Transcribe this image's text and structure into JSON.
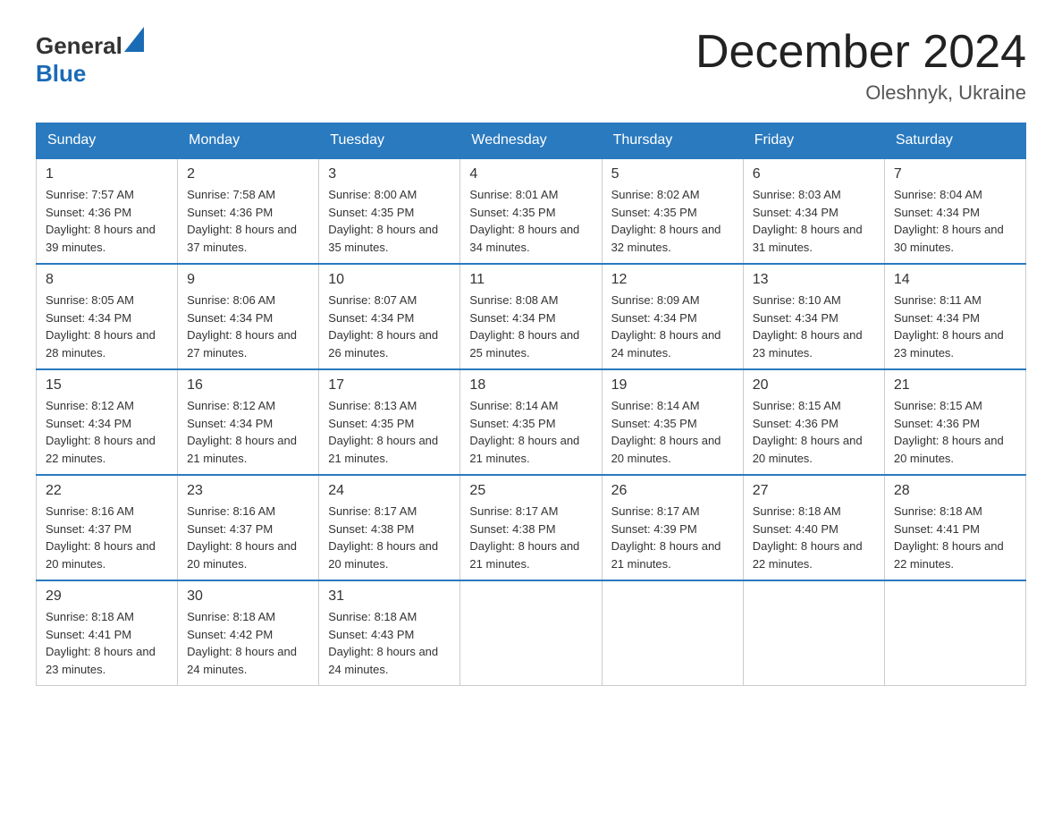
{
  "header": {
    "title": "December 2024",
    "location": "Oleshnyk, Ukraine",
    "logo_general": "General",
    "logo_blue": "Blue"
  },
  "days_of_week": [
    "Sunday",
    "Monday",
    "Tuesday",
    "Wednesday",
    "Thursday",
    "Friday",
    "Saturday"
  ],
  "weeks": [
    [
      {
        "day": "1",
        "sunrise": "7:57 AM",
        "sunset": "4:36 PM",
        "daylight": "8 hours and 39 minutes."
      },
      {
        "day": "2",
        "sunrise": "7:58 AM",
        "sunset": "4:36 PM",
        "daylight": "8 hours and 37 minutes."
      },
      {
        "day": "3",
        "sunrise": "8:00 AM",
        "sunset": "4:35 PM",
        "daylight": "8 hours and 35 minutes."
      },
      {
        "day": "4",
        "sunrise": "8:01 AM",
        "sunset": "4:35 PM",
        "daylight": "8 hours and 34 minutes."
      },
      {
        "day": "5",
        "sunrise": "8:02 AM",
        "sunset": "4:35 PM",
        "daylight": "8 hours and 32 minutes."
      },
      {
        "day": "6",
        "sunrise": "8:03 AM",
        "sunset": "4:34 PM",
        "daylight": "8 hours and 31 minutes."
      },
      {
        "day": "7",
        "sunrise": "8:04 AM",
        "sunset": "4:34 PM",
        "daylight": "8 hours and 30 minutes."
      }
    ],
    [
      {
        "day": "8",
        "sunrise": "8:05 AM",
        "sunset": "4:34 PM",
        "daylight": "8 hours and 28 minutes."
      },
      {
        "day": "9",
        "sunrise": "8:06 AM",
        "sunset": "4:34 PM",
        "daylight": "8 hours and 27 minutes."
      },
      {
        "day": "10",
        "sunrise": "8:07 AM",
        "sunset": "4:34 PM",
        "daylight": "8 hours and 26 minutes."
      },
      {
        "day": "11",
        "sunrise": "8:08 AM",
        "sunset": "4:34 PM",
        "daylight": "8 hours and 25 minutes."
      },
      {
        "day": "12",
        "sunrise": "8:09 AM",
        "sunset": "4:34 PM",
        "daylight": "8 hours and 24 minutes."
      },
      {
        "day": "13",
        "sunrise": "8:10 AM",
        "sunset": "4:34 PM",
        "daylight": "8 hours and 23 minutes."
      },
      {
        "day": "14",
        "sunrise": "8:11 AM",
        "sunset": "4:34 PM",
        "daylight": "8 hours and 23 minutes."
      }
    ],
    [
      {
        "day": "15",
        "sunrise": "8:12 AM",
        "sunset": "4:34 PM",
        "daylight": "8 hours and 22 minutes."
      },
      {
        "day": "16",
        "sunrise": "8:12 AM",
        "sunset": "4:34 PM",
        "daylight": "8 hours and 21 minutes."
      },
      {
        "day": "17",
        "sunrise": "8:13 AM",
        "sunset": "4:35 PM",
        "daylight": "8 hours and 21 minutes."
      },
      {
        "day": "18",
        "sunrise": "8:14 AM",
        "sunset": "4:35 PM",
        "daylight": "8 hours and 21 minutes."
      },
      {
        "day": "19",
        "sunrise": "8:14 AM",
        "sunset": "4:35 PM",
        "daylight": "8 hours and 20 minutes."
      },
      {
        "day": "20",
        "sunrise": "8:15 AM",
        "sunset": "4:36 PM",
        "daylight": "8 hours and 20 minutes."
      },
      {
        "day": "21",
        "sunrise": "8:15 AM",
        "sunset": "4:36 PM",
        "daylight": "8 hours and 20 minutes."
      }
    ],
    [
      {
        "day": "22",
        "sunrise": "8:16 AM",
        "sunset": "4:37 PM",
        "daylight": "8 hours and 20 minutes."
      },
      {
        "day": "23",
        "sunrise": "8:16 AM",
        "sunset": "4:37 PM",
        "daylight": "8 hours and 20 minutes."
      },
      {
        "day": "24",
        "sunrise": "8:17 AM",
        "sunset": "4:38 PM",
        "daylight": "8 hours and 20 minutes."
      },
      {
        "day": "25",
        "sunrise": "8:17 AM",
        "sunset": "4:38 PM",
        "daylight": "8 hours and 21 minutes."
      },
      {
        "day": "26",
        "sunrise": "8:17 AM",
        "sunset": "4:39 PM",
        "daylight": "8 hours and 21 minutes."
      },
      {
        "day": "27",
        "sunrise": "8:18 AM",
        "sunset": "4:40 PM",
        "daylight": "8 hours and 22 minutes."
      },
      {
        "day": "28",
        "sunrise": "8:18 AM",
        "sunset": "4:41 PM",
        "daylight": "8 hours and 22 minutes."
      }
    ],
    [
      {
        "day": "29",
        "sunrise": "8:18 AM",
        "sunset": "4:41 PM",
        "daylight": "8 hours and 23 minutes."
      },
      {
        "day": "30",
        "sunrise": "8:18 AM",
        "sunset": "4:42 PM",
        "daylight": "8 hours and 24 minutes."
      },
      {
        "day": "31",
        "sunrise": "8:18 AM",
        "sunset": "4:43 PM",
        "daylight": "8 hours and 24 minutes."
      },
      null,
      null,
      null,
      null
    ]
  ],
  "labels": {
    "sunrise": "Sunrise:",
    "sunset": "Sunset:",
    "daylight": "Daylight:"
  }
}
